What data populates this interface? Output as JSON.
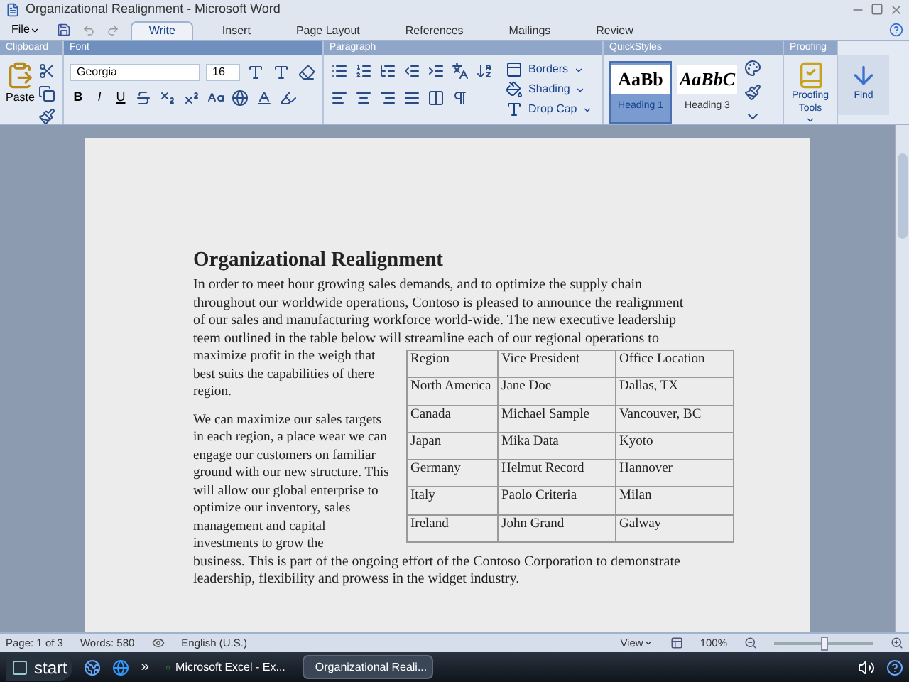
{
  "window": {
    "title": "Organizational Realignment - Microsoft Word"
  },
  "file_menu": "File",
  "tabs": [
    {
      "label": "Write",
      "selected": true
    },
    {
      "label": "Insert",
      "selected": false
    },
    {
      "label": "Page Layout",
      "selected": false
    },
    {
      "label": "References",
      "selected": false
    },
    {
      "label": "Mailings",
      "selected": false
    },
    {
      "label": "Review",
      "selected": false
    }
  ],
  "ribbon": {
    "groups": [
      "Clipboard",
      "Font",
      "Paragraph",
      "QuickStyles",
      "Proofing"
    ],
    "clipboard": {
      "paste": "Paste"
    },
    "font": {
      "name": "Georgia",
      "size": "16",
      "bold": "B",
      "italic": "I",
      "underline": "U"
    },
    "paragraph": {
      "buttons": [
        "Borders",
        "Shading",
        "Drop Cap"
      ]
    },
    "quick_styles": [
      {
        "sample": "AaBb",
        "label": "Heading 1",
        "selected": true
      },
      {
        "sample": "AaBbC",
        "label": "Heading 3",
        "selected": false
      }
    ],
    "proofing": "Proofing Tools",
    "find": "Find"
  },
  "document": {
    "title": "Organizational Realignment",
    "intro": "In order to meet hour growing sales demands, and to optimize the supply chain throughout our worldwide operations, Contoso is pleased to announce the realignment of our sales and manufacturing workforce world-wide. The new executive leadership teem outlined in the table below will streamline each of our regional operations to",
    "intro_continued": "maximize profit in the weigh that best suits the capabilities of there region.",
    "second": "We can maximize our sales targets in each region, a place wear we can engage our customers on familiar ground with our new structure. This will allow our global enterprise to optimize our inventory, sales management and capital investments to grow the",
    "second_continued": "business. This is part of the ongoing effort of the Contoso Corporation to demonstrate leadership, flexibility and prowess in the widget industry.",
    "table": {
      "columns": [
        "Region",
        "Vice President",
        "Office Location"
      ],
      "rows": [
        [
          "North America",
          "Jane Doe",
          "Dallas, TX"
        ],
        [
          "Canada",
          "Michael Sample",
          "Vancouver, BC"
        ],
        [
          "Japan",
          "Mika Data",
          "Kyoto"
        ],
        [
          "Germany",
          "Helmut Record",
          "Hannover"
        ],
        [
          "Italy",
          "Paolo Criteria",
          "Milan"
        ],
        [
          "Ireland",
          "John Grand",
          "Galway"
        ]
      ]
    }
  },
  "status_bar": {
    "page": "Page: 1 of 3",
    "words": "Words: 580",
    "language": "English (U.S.)",
    "view": "View",
    "zoom": "100%",
    "zoom_slider": {
      "level": 0.5
    }
  },
  "taskbar": {
    "start": "start",
    "more": "»",
    "tasks": [
      {
        "label": "Microsoft Excel - Ex...",
        "kind": "excel",
        "selected": false
      },
      {
        "label": "Organizational Reali...",
        "kind": "word",
        "selected": true
      }
    ]
  }
}
